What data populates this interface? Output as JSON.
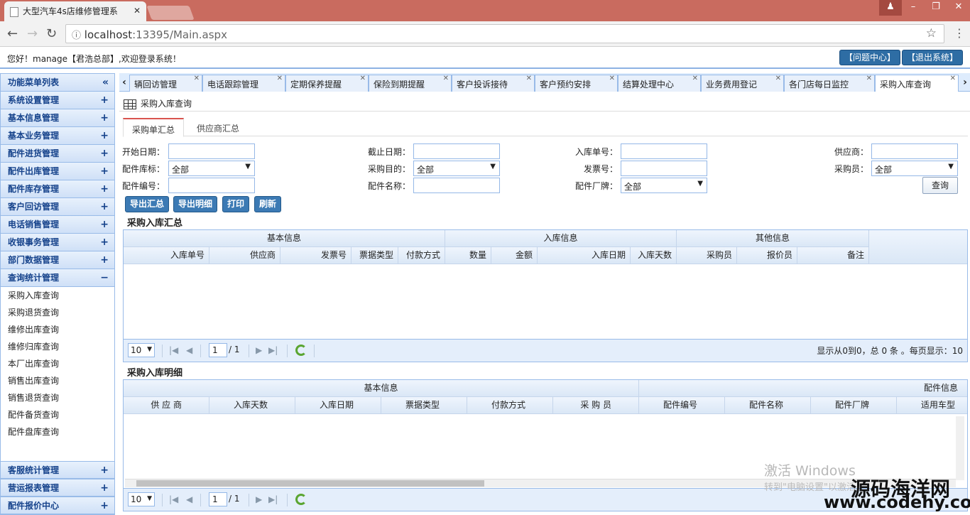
{
  "browser": {
    "tab_title": "大型汽车4s店维修管理系",
    "url_host": "localhost",
    "url_rest": ":13395/Main.aspx"
  },
  "header": {
    "welcome": "您好！manage【君浩总部】,欢迎登录系统！",
    "help_btn": "【问题中心】",
    "logout_btn": "【退出系统】"
  },
  "sidebar": {
    "title": "功能菜单列表",
    "groups": [
      {
        "label": "系统设置管理",
        "sign": "+"
      },
      {
        "label": "基本信息管理",
        "sign": "+"
      },
      {
        "label": "基本业务管理",
        "sign": "+"
      },
      {
        "label": "配件进货管理",
        "sign": "+"
      },
      {
        "label": "配件出库管理",
        "sign": "+"
      },
      {
        "label": "配件库存管理",
        "sign": "+"
      },
      {
        "label": "客户回访管理",
        "sign": "+"
      },
      {
        "label": "电话销售管理",
        "sign": "+"
      },
      {
        "label": "收银事务管理",
        "sign": "+"
      },
      {
        "label": "部门数据管理",
        "sign": "+"
      },
      {
        "label": "查询统计管理",
        "sign": "−"
      }
    ],
    "subitems": [
      "采购入库查询",
      "采购退货查询",
      "维修出库查询",
      "维修归库查询",
      "本厂出库查询",
      "销售出库查询",
      "销售退货查询",
      "配件备货查询",
      "配件盘库查询"
    ],
    "bottom_groups": [
      {
        "label": "客服统计管理",
        "sign": "+"
      },
      {
        "label": "营运报表管理",
        "sign": "+"
      },
      {
        "label": "配件报价中心",
        "sign": "+"
      }
    ]
  },
  "tabs": [
    "辆回访管理",
    "电话跟踪管理",
    "定期保养提醒",
    "保险到期提醒",
    "客户投诉接待",
    "客户预约安排",
    "结算处理中心",
    "业务费用登记",
    "各门店每日监控",
    "采购入库查询"
  ],
  "panel": {
    "title": "采购入库查询",
    "subtab1": "采购单汇总",
    "subtab2": "供应商汇总"
  },
  "form": {
    "start_date": "开始日期：",
    "end_date": "截止日期：",
    "in_no": "入库单号：",
    "supplier": "供应商：",
    "store": "配件库标：",
    "store_val": "全部",
    "purpose": "采购目的：",
    "purpose_val": "全部",
    "invoice": "发票号：",
    "buyer": "采购员：",
    "buyer_val": "全部",
    "part_no": "配件编号：",
    "part_name": "配件名称：",
    "brand": "配件厂牌：",
    "brand_val": "全部",
    "query_btn": "查询"
  },
  "actions": [
    "导出汇总",
    "导出明细",
    "打印",
    "刷新"
  ],
  "summary": {
    "title": "采购入库汇总",
    "groups": [
      "基本信息",
      "入库信息",
      "其他信息"
    ],
    "columns": [
      "入库单号",
      "供应商",
      "发票号",
      "票据类型",
      "付款方式",
      "数量",
      "金额",
      "入库日期",
      "入库天数",
      "采购员",
      "报价员",
      "备注"
    ],
    "page_size": "10",
    "page": "1",
    "total_pages": "/ 1",
    "status": "显示从0到0，总 0 条 。每页显示：10"
  },
  "detail": {
    "title": "采购入库明细",
    "groups": [
      "基本信息",
      "配件信息"
    ],
    "columns": [
      "供 应 商",
      "入库天数",
      "入库日期",
      "票据类型",
      "付款方式",
      "采 购 员",
      "配件编号",
      "配件名称",
      "配件厂牌",
      "适用车型"
    ],
    "page_size": "10",
    "page": "1",
    "total_pages": "/ 1"
  },
  "watermark": {
    "activate": "激活 Windows",
    "activate_sub": "转到\"电脑设置\"以激活",
    "site_cn": "源码海洋网",
    "site_url": "www.codehy.com"
  }
}
